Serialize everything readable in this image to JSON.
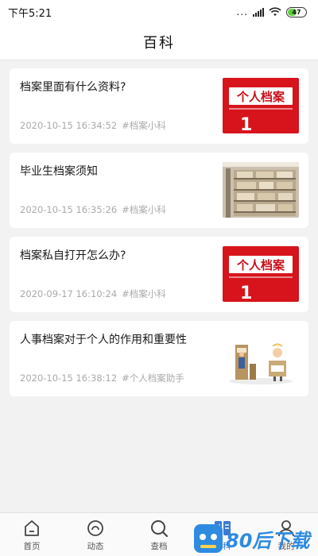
{
  "status_bar": {
    "time": "下午5:21",
    "dots": "...",
    "battery": "47"
  },
  "header": {
    "title": "百科"
  },
  "thumb_text": {
    "label_a": "个人档案",
    "label_b": "1"
  },
  "articles": [
    {
      "title": "档案里面有什么资料?",
      "date": "2020-10-15 16:34:52",
      "tag": "#档案小科",
      "thumb": "red-archive-sign"
    },
    {
      "title": "毕业生档案须知",
      "date": "2020-10-15 16:35:26",
      "tag": "#档案小科",
      "thumb": "archive-shelf-photo"
    },
    {
      "title": "档案私自打开怎么办?",
      "date": "2020-09-17 16:10:24",
      "tag": "#档案小科",
      "thumb": "red-archive-sign"
    },
    {
      "title": "人事档案对于个人的作用和重要性",
      "date": "2020-10-15 16:38:12",
      "tag": "#个人档案助手",
      "thumb": "cartoon-archive-illustration"
    }
  ],
  "tabbar": {
    "items": [
      {
        "label": "首页",
        "icon": "home-icon"
      },
      {
        "label": "动态",
        "icon": "dynamic-icon"
      },
      {
        "label": "查档",
        "icon": "search-icon"
      },
      {
        "label": "百科",
        "icon": "wiki-icon"
      },
      {
        "label": "我的",
        "icon": "user-icon"
      }
    ],
    "active_index": 3,
    "active_color": "#3a7bd5"
  },
  "watermark": {
    "text": "80后下载"
  }
}
